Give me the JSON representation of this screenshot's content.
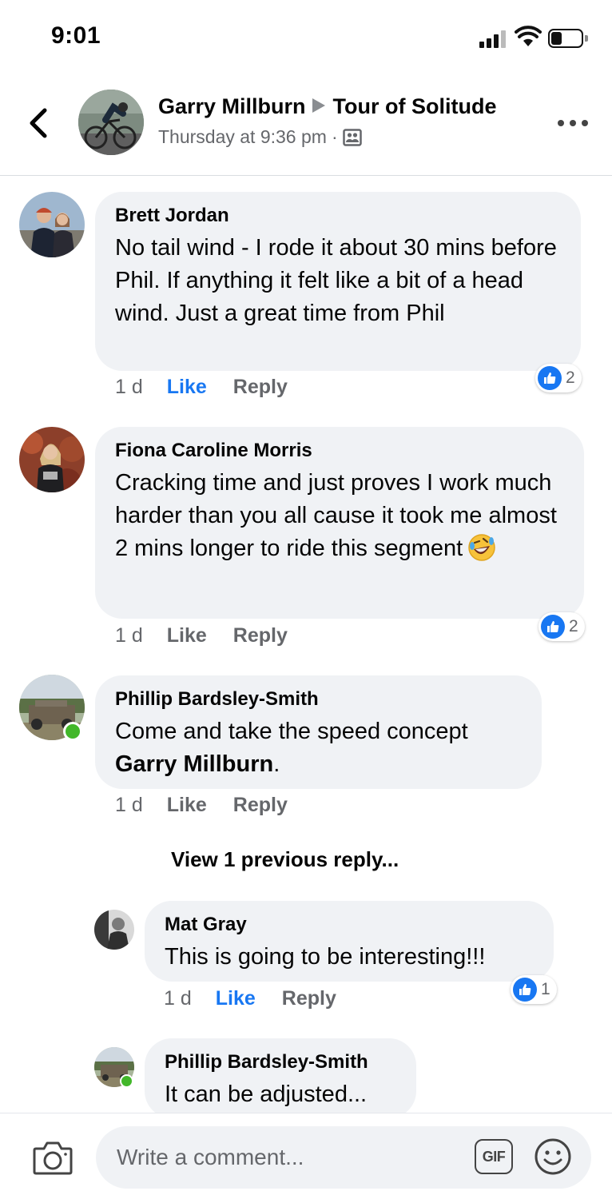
{
  "status_bar": {
    "time": "9:01"
  },
  "header": {
    "author": "Garry Millburn",
    "group": "Tour of Solitude",
    "timestamp": "Thursday at 9:36 pm",
    "separator": "·",
    "privacy_icon": "group-members-icon",
    "back_icon": "chevron-left-icon",
    "more_icon": "more-horizontal-icon"
  },
  "comments": [
    {
      "author": "Brett Jordan",
      "text": "No tail wind - I rode it about 30 mins before Phil. If anything it felt like a bit of a head wind. Just a great time from Phil",
      "age": "1 d",
      "like": "Like",
      "reply": "Reply",
      "liked": true,
      "reactions": "2"
    },
    {
      "author": "Fiona Caroline Morris",
      "text": "Cracking time and just proves I work much harder than you all cause it took me almost 2 mins longer to ride this segment",
      "emoji": "rolling-on-floor-laughing-emoji",
      "age": "1 d",
      "like": "Like",
      "reply": "Reply",
      "liked": false,
      "reactions": "2"
    },
    {
      "author": "Phillip Bardsley-Smith",
      "text": "Come and take the speed concept ",
      "mention": "Garry Millburn",
      "text_end": ".",
      "online": true,
      "age": "1 d",
      "like": "Like",
      "reply": "Reply",
      "liked": false
    }
  ],
  "view_previous": "View 1 previous reply...",
  "replies": [
    {
      "author": "Mat Gray",
      "text": "This is going to be interesting!!!",
      "age": "1 d",
      "like": "Like",
      "reply": "Reply",
      "liked": true,
      "reactions": "1"
    },
    {
      "author": "Phillip Bardsley-Smith",
      "text": "It can be adjusted...",
      "online": true
    }
  ],
  "composer": {
    "placeholder": "Write a comment...",
    "gif_label": "GIF",
    "camera_icon": "camera-icon",
    "emoji_icon": "smiley-icon"
  },
  "colors": {
    "accent": "#1877f2",
    "bubble": "#f0f2f5",
    "secondary_text": "#65676b",
    "online": "#42b72a"
  }
}
